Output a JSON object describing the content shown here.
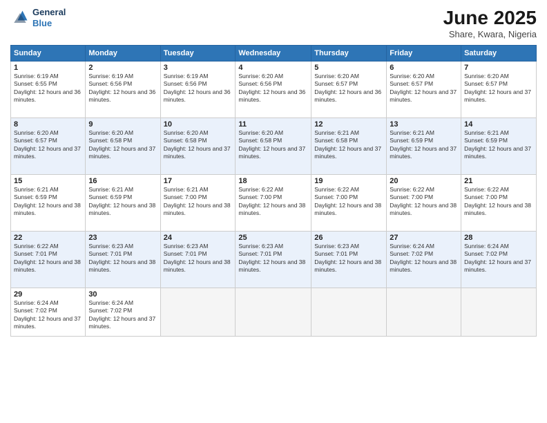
{
  "logo": {
    "line1": "General",
    "line2": "Blue"
  },
  "title": "June 2025",
  "location": "Share, Kwara, Nigeria",
  "days_header": [
    "Sunday",
    "Monday",
    "Tuesday",
    "Wednesday",
    "Thursday",
    "Friday",
    "Saturday"
  ],
  "weeks": [
    [
      {
        "day": "1",
        "sunrise": "6:19 AM",
        "sunset": "6:55 PM",
        "daylight": "12 hours and 36 minutes."
      },
      {
        "day": "2",
        "sunrise": "6:19 AM",
        "sunset": "6:56 PM",
        "daylight": "12 hours and 36 minutes."
      },
      {
        "day": "3",
        "sunrise": "6:19 AM",
        "sunset": "6:56 PM",
        "daylight": "12 hours and 36 minutes."
      },
      {
        "day": "4",
        "sunrise": "6:20 AM",
        "sunset": "6:56 PM",
        "daylight": "12 hours and 36 minutes."
      },
      {
        "day": "5",
        "sunrise": "6:20 AM",
        "sunset": "6:57 PM",
        "daylight": "12 hours and 36 minutes."
      },
      {
        "day": "6",
        "sunrise": "6:20 AM",
        "sunset": "6:57 PM",
        "daylight": "12 hours and 37 minutes."
      },
      {
        "day": "7",
        "sunrise": "6:20 AM",
        "sunset": "6:57 PM",
        "daylight": "12 hours and 37 minutes."
      }
    ],
    [
      {
        "day": "8",
        "sunrise": "6:20 AM",
        "sunset": "6:57 PM",
        "daylight": "12 hours and 37 minutes."
      },
      {
        "day": "9",
        "sunrise": "6:20 AM",
        "sunset": "6:58 PM",
        "daylight": "12 hours and 37 minutes."
      },
      {
        "day": "10",
        "sunrise": "6:20 AM",
        "sunset": "6:58 PM",
        "daylight": "12 hours and 37 minutes."
      },
      {
        "day": "11",
        "sunrise": "6:20 AM",
        "sunset": "6:58 PM",
        "daylight": "12 hours and 37 minutes."
      },
      {
        "day": "12",
        "sunrise": "6:21 AM",
        "sunset": "6:58 PM",
        "daylight": "12 hours and 37 minutes."
      },
      {
        "day": "13",
        "sunrise": "6:21 AM",
        "sunset": "6:59 PM",
        "daylight": "12 hours and 37 minutes."
      },
      {
        "day": "14",
        "sunrise": "6:21 AM",
        "sunset": "6:59 PM",
        "daylight": "12 hours and 37 minutes."
      }
    ],
    [
      {
        "day": "15",
        "sunrise": "6:21 AM",
        "sunset": "6:59 PM",
        "daylight": "12 hours and 38 minutes."
      },
      {
        "day": "16",
        "sunrise": "6:21 AM",
        "sunset": "6:59 PM",
        "daylight": "12 hours and 38 minutes."
      },
      {
        "day": "17",
        "sunrise": "6:21 AM",
        "sunset": "7:00 PM",
        "daylight": "12 hours and 38 minutes."
      },
      {
        "day": "18",
        "sunrise": "6:22 AM",
        "sunset": "7:00 PM",
        "daylight": "12 hours and 38 minutes."
      },
      {
        "day": "19",
        "sunrise": "6:22 AM",
        "sunset": "7:00 PM",
        "daylight": "12 hours and 38 minutes."
      },
      {
        "day": "20",
        "sunrise": "6:22 AM",
        "sunset": "7:00 PM",
        "daylight": "12 hours and 38 minutes."
      },
      {
        "day": "21",
        "sunrise": "6:22 AM",
        "sunset": "7:00 PM",
        "daylight": "12 hours and 38 minutes."
      }
    ],
    [
      {
        "day": "22",
        "sunrise": "6:22 AM",
        "sunset": "7:01 PM",
        "daylight": "12 hours and 38 minutes."
      },
      {
        "day": "23",
        "sunrise": "6:23 AM",
        "sunset": "7:01 PM",
        "daylight": "12 hours and 38 minutes."
      },
      {
        "day": "24",
        "sunrise": "6:23 AM",
        "sunset": "7:01 PM",
        "daylight": "12 hours and 38 minutes."
      },
      {
        "day": "25",
        "sunrise": "6:23 AM",
        "sunset": "7:01 PM",
        "daylight": "12 hours and 38 minutes."
      },
      {
        "day": "26",
        "sunrise": "6:23 AM",
        "sunset": "7:01 PM",
        "daylight": "12 hours and 38 minutes."
      },
      {
        "day": "27",
        "sunrise": "6:24 AM",
        "sunset": "7:02 PM",
        "daylight": "12 hours and 38 minutes."
      },
      {
        "day": "28",
        "sunrise": "6:24 AM",
        "sunset": "7:02 PM",
        "daylight": "12 hours and 37 minutes."
      }
    ],
    [
      {
        "day": "29",
        "sunrise": "6:24 AM",
        "sunset": "7:02 PM",
        "daylight": "12 hours and 37 minutes."
      },
      {
        "day": "30",
        "sunrise": "6:24 AM",
        "sunset": "7:02 PM",
        "daylight": "12 hours and 37 minutes."
      },
      null,
      null,
      null,
      null,
      null
    ]
  ]
}
